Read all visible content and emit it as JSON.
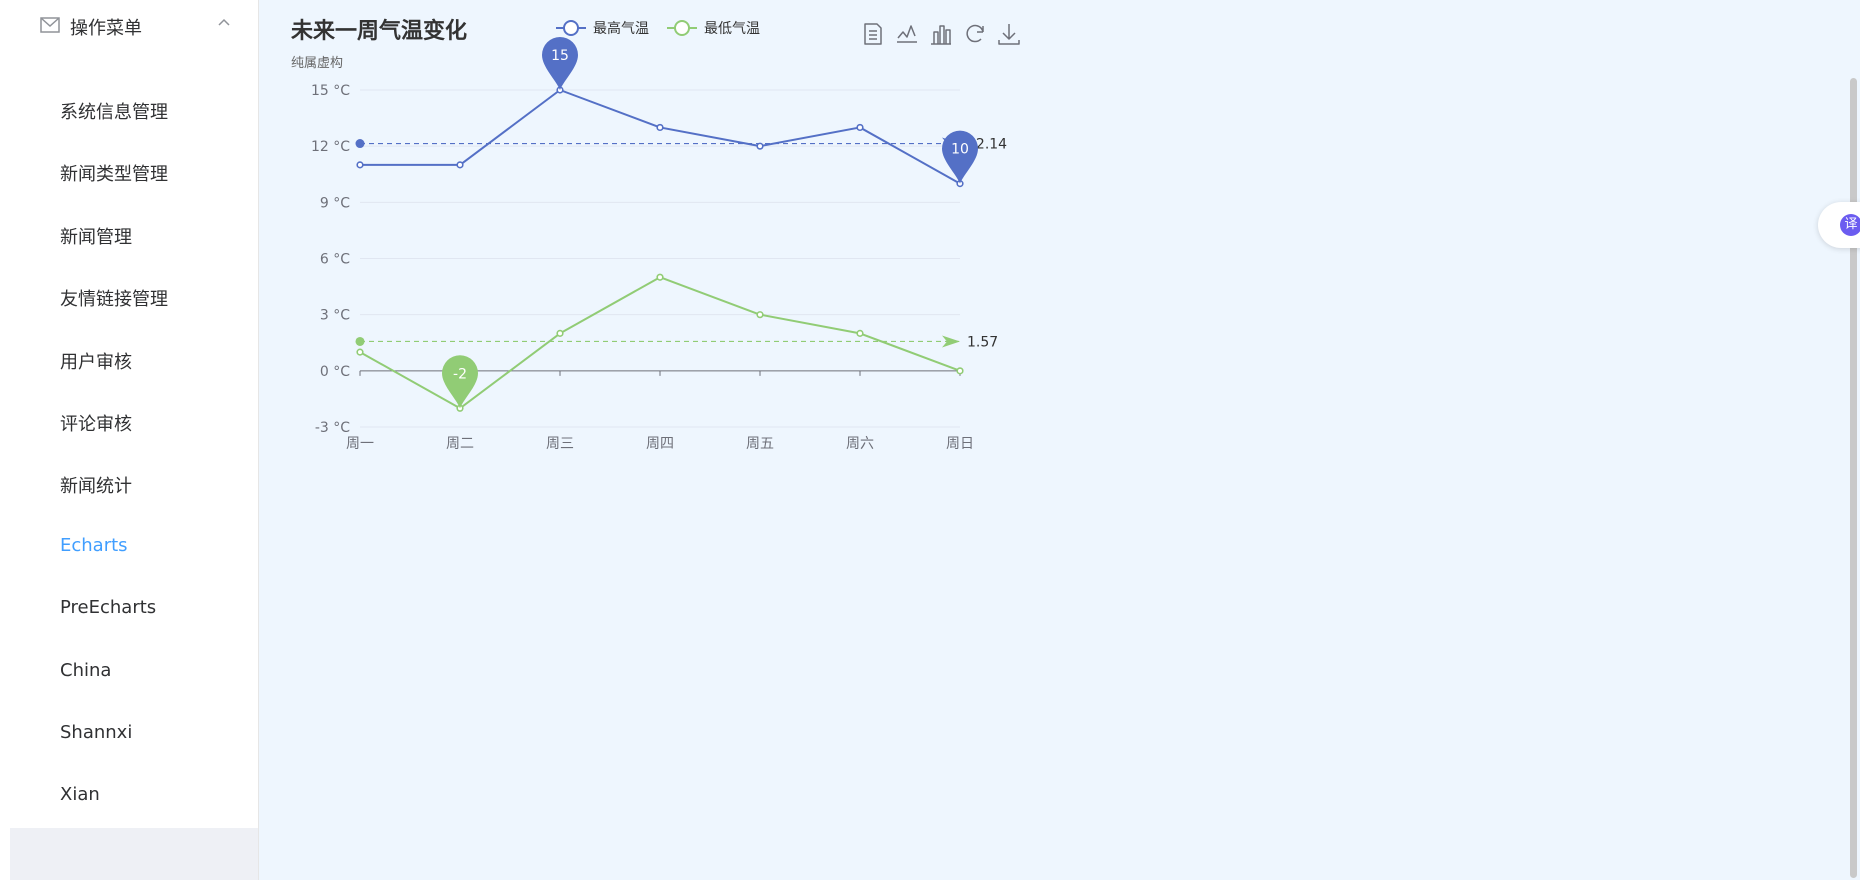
{
  "sidebar": {
    "submenu_title": "操作菜单",
    "items": [
      {
        "label": "系统信息管理",
        "active": false
      },
      {
        "label": "新闻类型管理",
        "active": false
      },
      {
        "label": "新闻管理",
        "active": false
      },
      {
        "label": "友情链接管理",
        "active": false
      },
      {
        "label": "用户审核",
        "active": false
      },
      {
        "label": "评论审核",
        "active": false
      },
      {
        "label": "新闻统计",
        "active": false
      },
      {
        "label": "Echarts",
        "active": true
      },
      {
        "label": "PreEcharts",
        "active": false
      },
      {
        "label": "China",
        "active": false
      },
      {
        "label": "Shannxi",
        "active": false
      },
      {
        "label": "Xian",
        "active": false
      }
    ]
  },
  "translate_button": {
    "label": "译"
  },
  "toolbox": {
    "icons": [
      "data-view-icon",
      "line-chart-icon",
      "bar-chart-icon",
      "restore-icon",
      "save-image-icon"
    ]
  },
  "chart_data": {
    "type": "line",
    "title": "未来一周气温变化",
    "subtitle": "纯属虚构",
    "categories": [
      "周一",
      "周二",
      "周三",
      "周四",
      "周五",
      "周六",
      "周日"
    ],
    "ylim": [
      -3,
      15
    ],
    "yticks": [
      -3,
      0,
      3,
      6,
      9,
      12,
      15
    ],
    "y_unit": "°C",
    "legend_position": "top-center",
    "grid": true,
    "series": [
      {
        "name": "最高气温",
        "color": "#5470c6",
        "values": [
          11,
          11,
          15,
          13,
          12,
          13,
          10
        ],
        "mark_points": [
          {
            "label": "15",
            "category": "周三",
            "value": 15
          },
          {
            "label": "10",
            "category": "周日",
            "value": 10
          }
        ],
        "average": 12.14,
        "average_label": "12.14"
      },
      {
        "name": "最低气温",
        "color": "#91cc75",
        "values": [
          1,
          -2,
          2,
          5,
          3,
          2,
          0
        ],
        "mark_points": [
          {
            "label": "-2",
            "category": "周二",
            "value": -2
          }
        ],
        "average": 1.57,
        "average_label": "1.57"
      }
    ]
  }
}
